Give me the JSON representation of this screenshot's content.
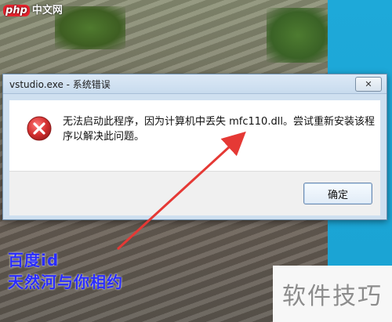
{
  "watermark": {
    "brand": "php",
    "site": "中文网"
  },
  "dialog": {
    "title": "vstudio.exe - 系统错误",
    "close_symbol": "✕",
    "message": "无法启动此程序，因为计算机中丢失 mfc110.dll。尝试重新安装该程序以解决此问题。",
    "ok_label": "确定"
  },
  "annotation": {
    "arrow_color": "#e53935"
  },
  "overlay_text": {
    "line1": "百度id",
    "line2": "天然河与你相约",
    "color": "#2a2cff"
  },
  "corner_label": "软件技巧",
  "colors": {
    "teal_background": "#1ea9d9",
    "error_red": "#d32f2f"
  }
}
